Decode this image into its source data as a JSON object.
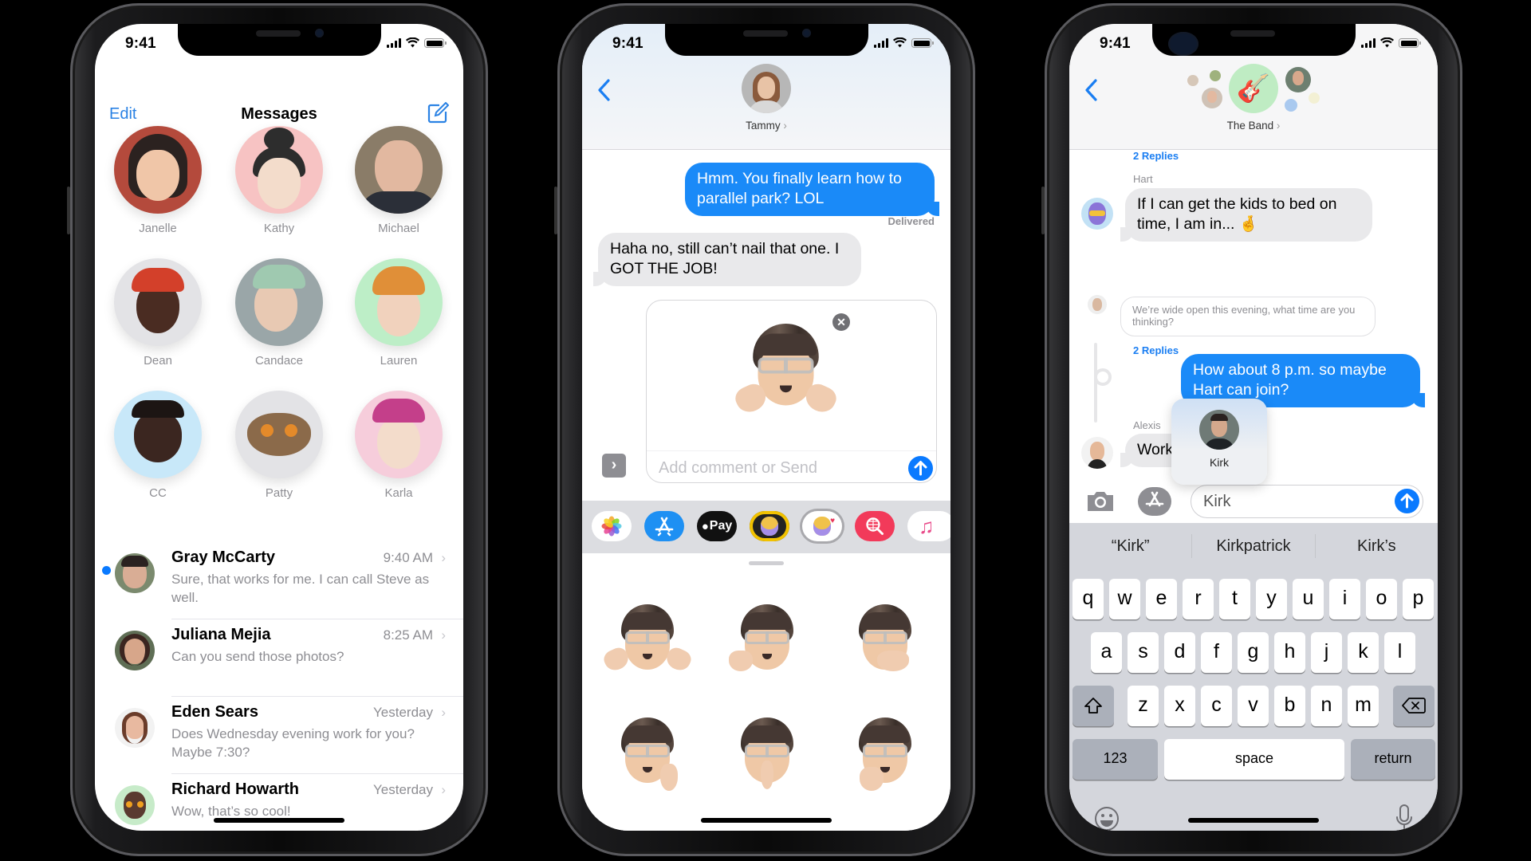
{
  "status_bar": {
    "time": "9:41"
  },
  "phone1": {
    "nav": {
      "edit": "Edit",
      "title": "Messages",
      "compose_icon": "compose-icon"
    },
    "pinned": [
      {
        "name": "Janelle",
        "bg": "#b44a3c"
      },
      {
        "name": "Kathy",
        "bg": "#f7c3c3"
      },
      {
        "name": "Michael",
        "bg": "#8a7c68"
      },
      {
        "name": "Dean",
        "bg": "#e3e3e6"
      },
      {
        "name": "Candace",
        "bg": "#9aa6a8"
      },
      {
        "name": "Lauren",
        "bg": "#bdeec7"
      },
      {
        "name": "CC",
        "bg": "#c8e8f9"
      },
      {
        "name": "Patty",
        "bg": "#e3e3e6"
      },
      {
        "name": "Karla",
        "bg": "#f6cddb"
      }
    ],
    "conversations": [
      {
        "name": "Gray McCarty",
        "time": "9:40 AM",
        "preview": "Sure, that works for me. I can call Steve as well.",
        "unread": true
      },
      {
        "name": "Juliana Mejia",
        "time": "8:25 AM",
        "preview": "Can you send those photos?",
        "unread": false
      },
      {
        "name": "Eden Sears",
        "time": "Yesterday",
        "preview": "Does Wednesday evening work for you? Maybe 7:30?",
        "unread": false
      },
      {
        "name": "Richard Howarth",
        "time": "Yesterday",
        "preview": "Wow, that’s so cool!",
        "unread": false
      }
    ]
  },
  "phone2": {
    "contact": "Tammy",
    "messages": [
      {
        "dir": "out",
        "text": "Hmm. You finally learn how to parallel park? LOL"
      },
      {
        "dir": "in",
        "text": "Haha no, still can’t nail that one. I GOT THE JOB!"
      }
    ],
    "delivered": "Delivered",
    "compose_placeholder": "Add comment or Send",
    "app_strip": [
      "photos",
      "app-store",
      "apple-pay",
      "memoji",
      "memoji-stickers",
      "web-images",
      "music"
    ],
    "apple_pay_label": "Pay",
    "sticker_count": 6
  },
  "phone3": {
    "group": "The Band",
    "replies_top": "2 Replies",
    "hart_sender": "Hart",
    "hart_message": "If I can get the kids to bed on time, I am in... 🤞",
    "quoted": "We’re wide open this evening, what time are you thinking?",
    "replies_mid": "2 Replies",
    "out_message": "How about 8 p.m. so maybe Hart can join?",
    "alexis_sender": "Alexis",
    "alexis_message": "Work",
    "mention_name": "Kirk",
    "input_value": "Kirk",
    "suggestions": [
      "“Kirk”",
      "Kirkpatrick",
      "Kirk’s"
    ],
    "keys_row1": [
      "q",
      "w",
      "e",
      "r",
      "t",
      "y",
      "u",
      "i",
      "o",
      "p"
    ],
    "keys_row2": [
      "a",
      "s",
      "d",
      "f",
      "g",
      "h",
      "j",
      "k",
      "l"
    ],
    "keys_row3": [
      "z",
      "x",
      "c",
      "v",
      "b",
      "n",
      "m"
    ],
    "key_123": "123",
    "key_space": "space",
    "key_return": "return"
  },
  "colors": {
    "accent": "#1a7ef2",
    "bubble_out": "#1a8af8",
    "bubble_in": "#e9e9eb"
  }
}
